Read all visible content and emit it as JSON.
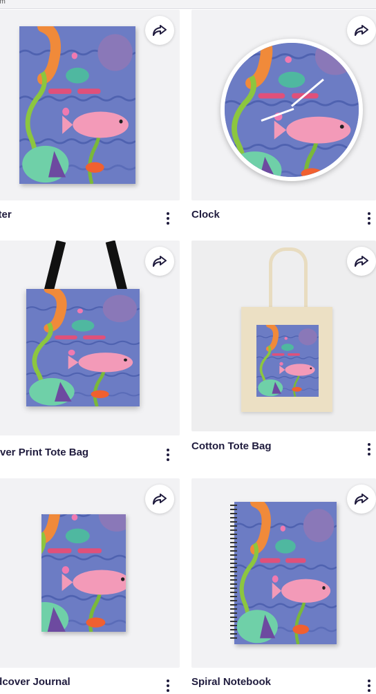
{
  "top_strip": {
    "text": "om"
  },
  "products": [
    {
      "title": "oster",
      "share_label": "Share",
      "more_label": "More options"
    },
    {
      "title": "Clock",
      "share_label": "Share",
      "more_label": "More options"
    },
    {
      "title": "l Over Print Tote Bag",
      "share_label": "Share",
      "more_label": "More options"
    },
    {
      "title": "Cotton Tote Bag",
      "share_label": "Share",
      "more_label": "More options"
    },
    {
      "title": "ardcover Journal",
      "share_label": "Share",
      "more_label": "More options"
    },
    {
      "title": "Spiral Notebook",
      "share_label": "Share",
      "more_label": "More options"
    }
  ],
  "icons": {
    "share": "share-arrow-icon",
    "more": "vertical-dots-icon"
  },
  "colors": {
    "text": "#1f1b3d",
    "card_bg": "#f2f2f4",
    "art_blue": "#6878c0",
    "fish_pink": "#f08fb0",
    "fish_orange": "#f08a3a",
    "weed_green": "#8cc63f"
  }
}
